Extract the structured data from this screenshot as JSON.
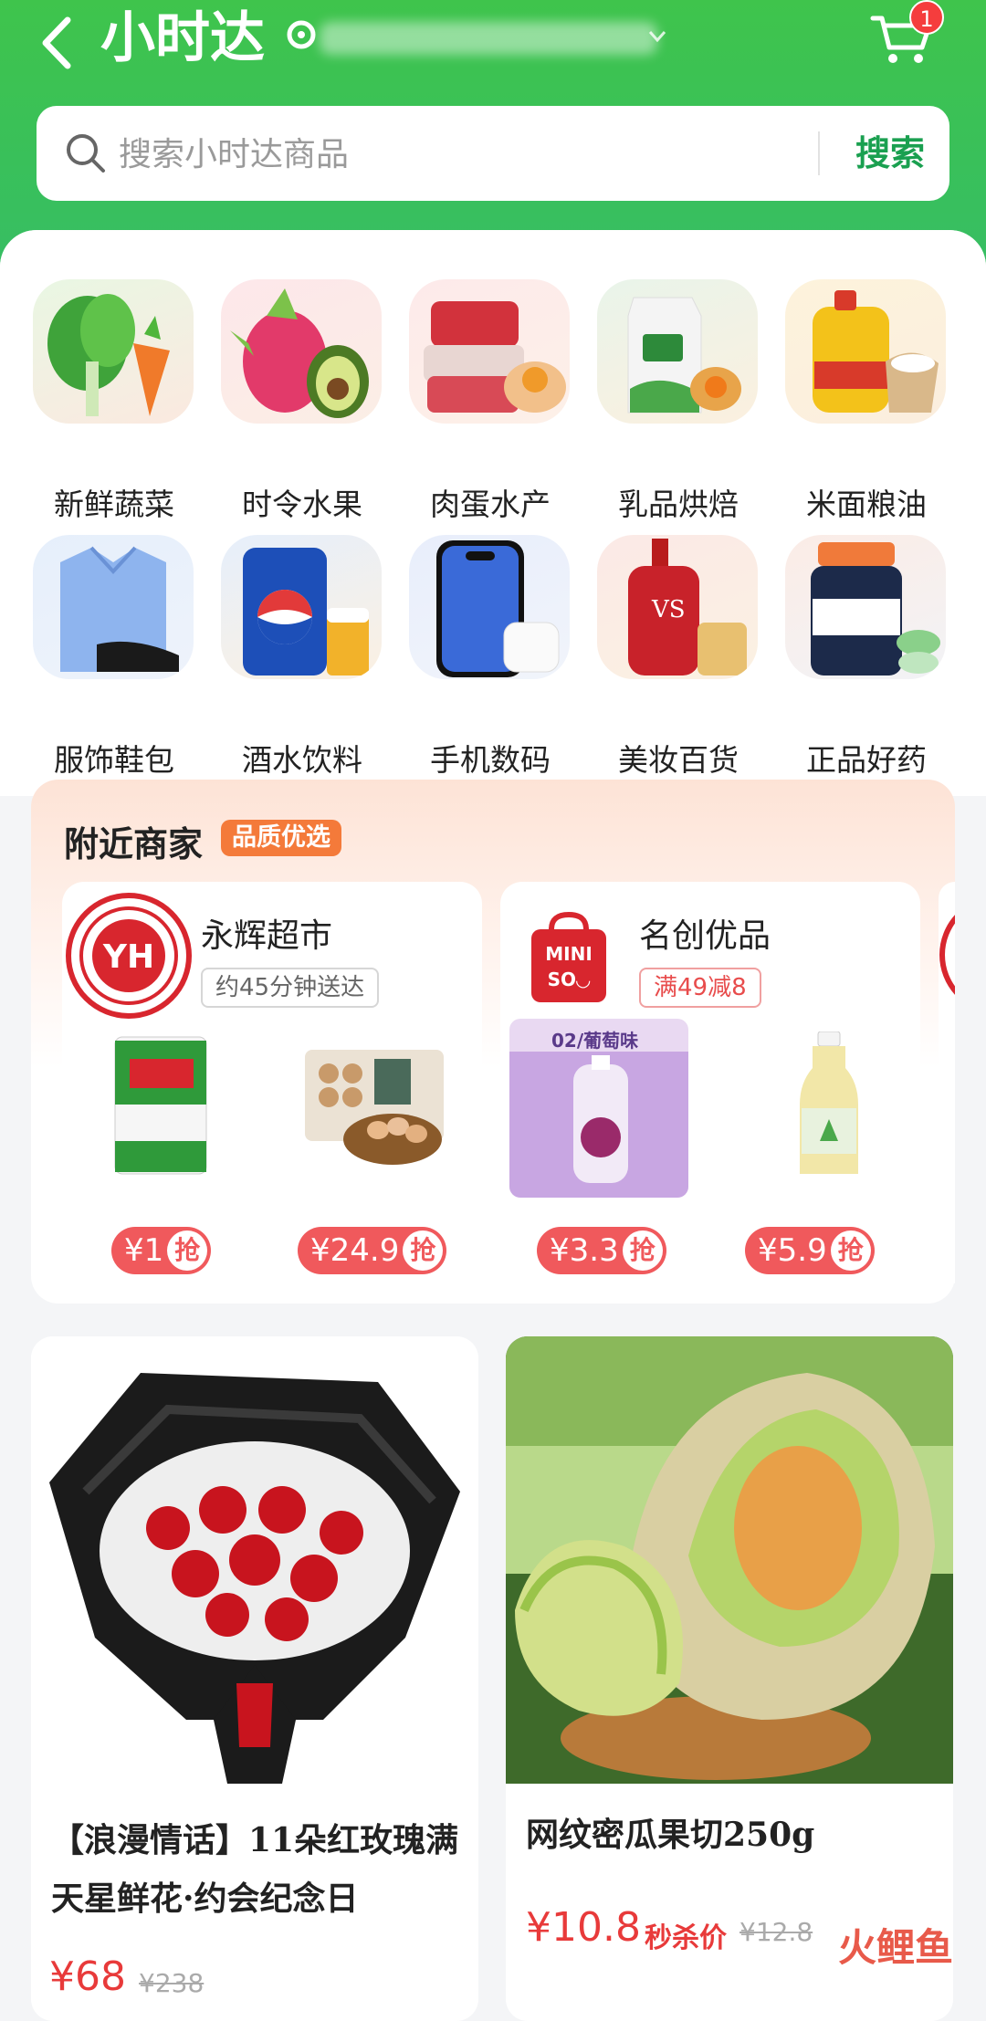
{
  "header": {
    "title": "小时达",
    "cart_badge": "1",
    "colors": {
      "brand_green": "#3fc44c",
      "accent_red": "#f53d3d"
    }
  },
  "search": {
    "placeholder": "搜索小时达商品",
    "button": "搜索"
  },
  "categories": [
    {
      "label": "新鲜蔬菜",
      "icon": "vegetables-icon"
    },
    {
      "label": "时令水果",
      "icon": "fruit-icon"
    },
    {
      "label": "肉蛋水产",
      "icon": "meat-egg-icon"
    },
    {
      "label": "乳品烘焙",
      "icon": "dairy-bakery-icon"
    },
    {
      "label": "米面粮油",
      "icon": "rice-oil-icon"
    },
    {
      "label": "服饰鞋包",
      "icon": "clothing-icon"
    },
    {
      "label": "酒水饮料",
      "icon": "drinks-icon"
    },
    {
      "label": "手机数码",
      "icon": "phone-icon"
    },
    {
      "label": "美妆百货",
      "icon": "cosmetics-icon"
    },
    {
      "label": "正品好药",
      "icon": "medicine-icon"
    }
  ],
  "nearby": {
    "title": "附近商家",
    "tag": "品质优选",
    "stores": [
      {
        "name": "永辉超市",
        "logo_text": "YH",
        "sub": "约45分钟送达",
        "products": [
          {
            "price": "¥1",
            "badge": "抢"
          },
          {
            "price": "¥24.9",
            "badge": "抢"
          }
        ]
      },
      {
        "name": "名创优品",
        "logo_text": "MINI SO",
        "sub": "满49减8",
        "products": [
          {
            "price": "¥3.3",
            "badge": "抢",
            "label": "02/葡萄味"
          },
          {
            "price": "¥5.9",
            "badge": "抢"
          }
        ]
      }
    ]
  },
  "feed": [
    {
      "title": "【浪漫情话】11朵红玫瑰满天星鲜花·约会纪念日",
      "price": "¥68",
      "original_price": "¥238"
    },
    {
      "title": "网纹密瓜果切250g",
      "price": "¥10.8",
      "tag": "秒杀价",
      "original_price": "¥12.8"
    }
  ],
  "watermark": "火鲤鱼"
}
